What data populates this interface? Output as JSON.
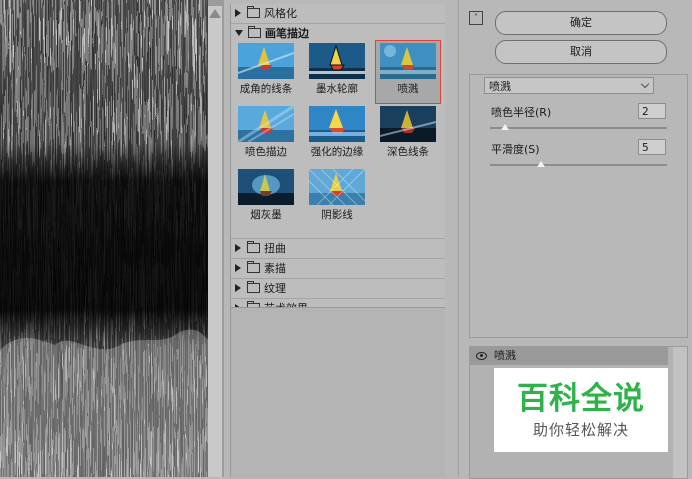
{
  "gallery": {
    "folders_top": [
      {
        "label": "风格化",
        "expanded": false
      }
    ],
    "open_folder": {
      "label": "画笔描边",
      "expanded": true
    },
    "thumbnails": [
      {
        "label": "成角的线条",
        "selected": false
      },
      {
        "label": "墨水轮廓",
        "selected": false
      },
      {
        "label": "喷溅",
        "selected": true
      },
      {
        "label": "喷色描边",
        "selected": false
      },
      {
        "label": "强化的边缘",
        "selected": false
      },
      {
        "label": "深色线条",
        "selected": false
      },
      {
        "label": "烟灰墨",
        "selected": false
      },
      {
        "label": "阴影线",
        "selected": false
      }
    ],
    "folders_bottom": [
      {
        "label": "扭曲"
      },
      {
        "label": "素描"
      },
      {
        "label": "纹理"
      },
      {
        "label": "艺术效果"
      }
    ]
  },
  "panel": {
    "collapse_icon": "collapse-up-icon",
    "ok_label": "确定",
    "cancel_label": "取消",
    "filter_select": "喷溅",
    "params": [
      {
        "label": "喷色半径(R)",
        "value": "2",
        "fraction": 0.1
      },
      {
        "label": "平滑度(S)",
        "value": "5",
        "fraction": 0.33
      }
    ]
  },
  "layers": {
    "items": [
      {
        "name": "喷溅",
        "visible": true,
        "icon": "eye-icon"
      }
    ]
  },
  "watermark": {
    "title": "百科全说",
    "subtitle": "助你轻松解决",
    "color": "#2db34a"
  },
  "colors": {
    "selection_outline": "#e0413a"
  }
}
